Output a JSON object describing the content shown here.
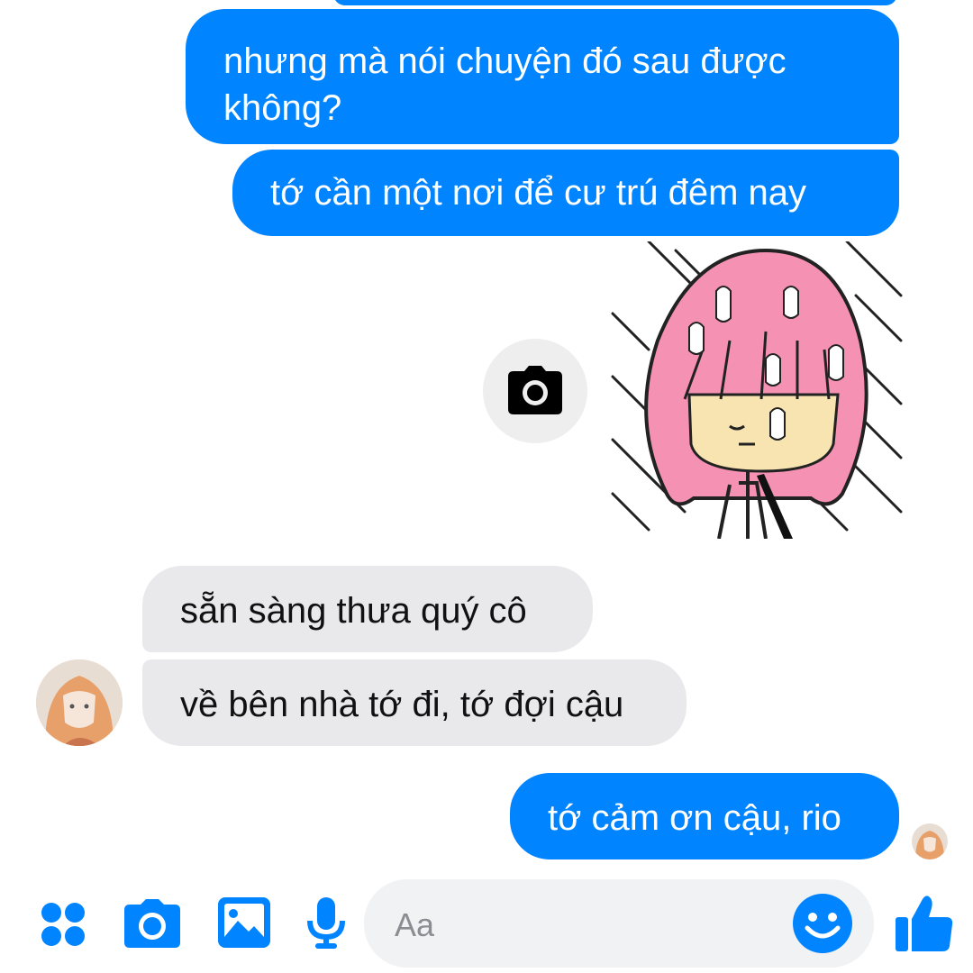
{
  "conversation": {
    "messages": [
      {
        "from": "me",
        "text": "nhưng mà nói chuyện đó sau được không?"
      },
      {
        "from": "me",
        "text": "tớ cần một nơi để cư trú đêm nay"
      },
      {
        "from": "me",
        "type": "sticker",
        "sticker": "pink-haired-girl-in-rain"
      },
      {
        "from": "other",
        "text": "sẵn sàng thưa quý cô"
      },
      {
        "from": "other",
        "text": "về bên nhà tớ đi, tớ đợi cậu"
      },
      {
        "from": "me",
        "text": "tớ cảm ơn cậu, rio"
      }
    ]
  },
  "composer": {
    "placeholder": "Aa",
    "icons": [
      "apps-icon",
      "camera-icon",
      "gallery-icon",
      "microphone-icon",
      "emoji-icon",
      "thumbs-up-icon"
    ]
  },
  "colors": {
    "accent": "#0084ff",
    "incoming_bubble": "#e9e9eb",
    "composer_bg": "#f1f2f4"
  }
}
